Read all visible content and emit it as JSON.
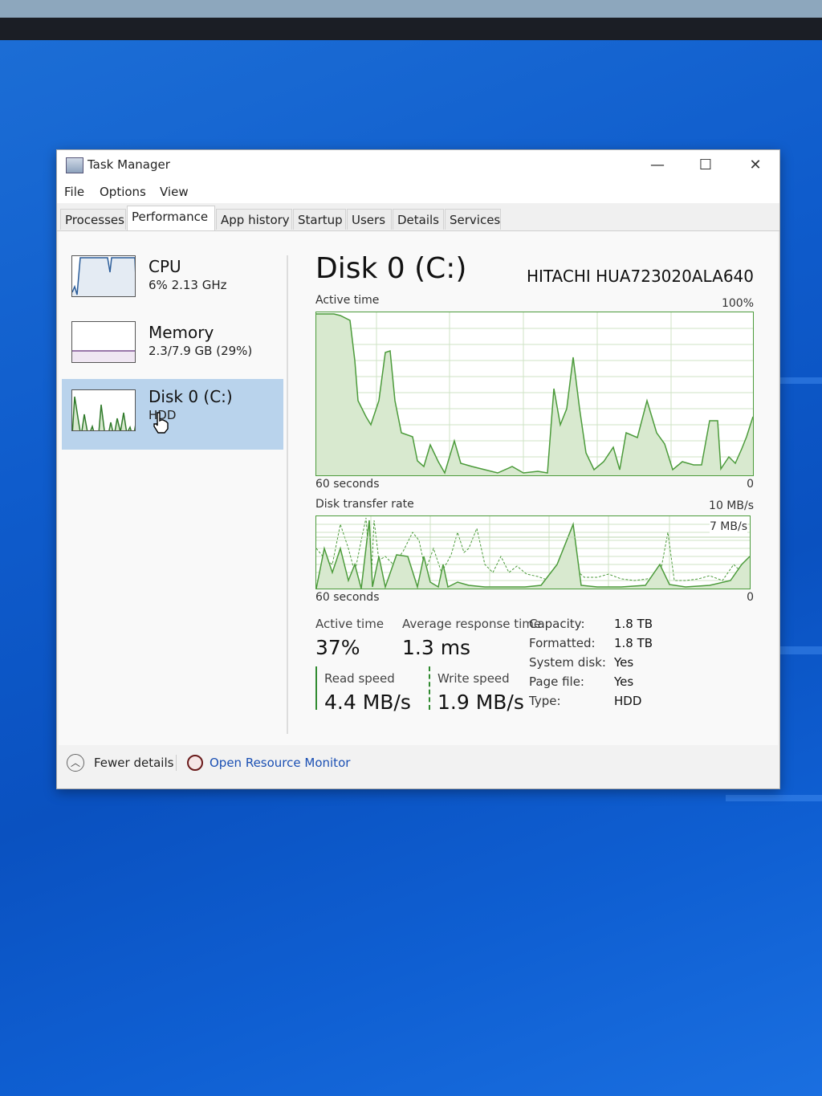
{
  "window": {
    "title": "Task Manager",
    "controls": {
      "minimize": "—",
      "maximize": "☐",
      "close": "✕"
    }
  },
  "menu": [
    "File",
    "Options",
    "View"
  ],
  "tabs": [
    "Processes",
    "Performance",
    "App history",
    "Startup",
    "Users",
    "Details",
    "Services"
  ],
  "active_tab": "Performance",
  "sidebar": {
    "items": [
      {
        "name": "CPU",
        "detail": "6% 2.13 GHz"
      },
      {
        "name": "Memory",
        "detail": "2.3/7.9 GB (29%)"
      },
      {
        "name": "Disk 0 (C:)",
        "detail": "HDD",
        "selected": true
      }
    ]
  },
  "disk": {
    "title": "Disk 0 (C:)",
    "model": "HITACHI HUA723020ALA640",
    "active_graph": {
      "label": "Active time",
      "max": "100%",
      "time_left": "60 seconds",
      "time_right": "0"
    },
    "transfer_graph": {
      "label": "Disk transfer rate",
      "max": "10 MB/s",
      "mid_label": "7 MB/s",
      "time_left": "60 seconds",
      "time_right": "0"
    },
    "stats": {
      "active_time_label": "Active time",
      "active_time_value": "37%",
      "response_label": "Average response time",
      "response_value": "1.3 ms",
      "read_label": "Read speed",
      "read_value": "4.4 MB/s",
      "write_label": "Write speed",
      "write_value": "1.9 MB/s"
    },
    "properties": [
      {
        "key": "Capacity:",
        "value": "1.8 TB"
      },
      {
        "key": "Formatted:",
        "value": "1.8 TB"
      },
      {
        "key": "System disk:",
        "value": "Yes"
      },
      {
        "key": "Page file:",
        "value": "Yes"
      },
      {
        "key": "Type:",
        "value": "HDD"
      }
    ]
  },
  "footer": {
    "fewer_details": "Fewer details",
    "resource_monitor": "Open Resource Monitor"
  },
  "colors": {
    "graph_line": "#4c9b3b",
    "graph_fill": "#d8e9cf",
    "selection": "#b9d3ec",
    "link": "#1a4fb3",
    "desktop": "#0f5ccc"
  },
  "icons": {
    "app": "task-manager-icon",
    "fewer": "chevron-up-icon",
    "monitor": "resource-monitor-icon",
    "cursor": "hand-cursor-icon"
  }
}
